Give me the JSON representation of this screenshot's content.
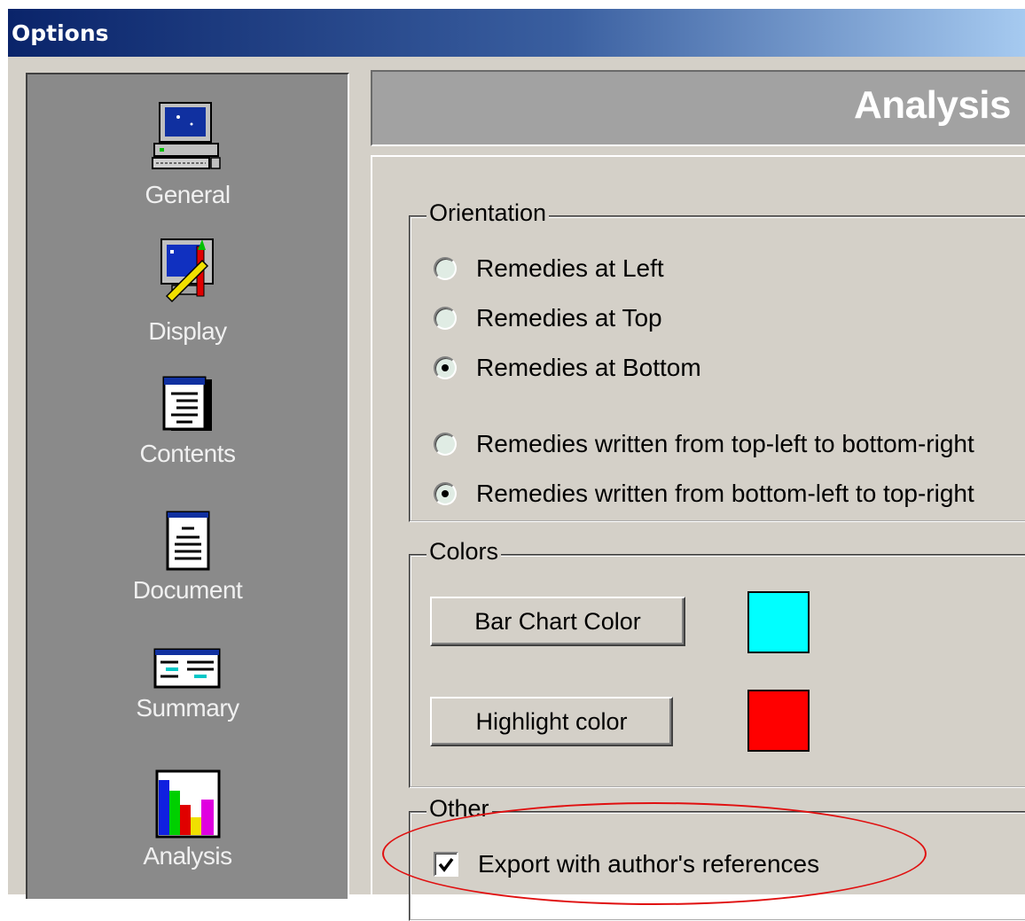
{
  "window": {
    "title": "Options"
  },
  "nav": {
    "items": [
      {
        "label": "General",
        "icon": "computer-icon"
      },
      {
        "label": "Display",
        "icon": "display-settings-icon"
      },
      {
        "label": "Contents",
        "icon": "contents-window-icon"
      },
      {
        "label": "Document",
        "icon": "document-icon"
      },
      {
        "label": "Summary",
        "icon": "summary-table-icon"
      },
      {
        "label": "Analysis",
        "icon": "bar-chart-icon",
        "selected": true
      }
    ]
  },
  "page": {
    "title": "Analysis"
  },
  "orientation": {
    "label": "Orientation",
    "options": [
      {
        "label": "Remedies at Left",
        "checked": false
      },
      {
        "label": "Remedies at Top",
        "checked": false
      },
      {
        "label": "Remedies at Bottom",
        "checked": true
      },
      {
        "label": "Remedies written from top-left to bottom-right",
        "checked": false
      },
      {
        "label": "Remedies written from bottom-left to top-right",
        "checked": true
      }
    ]
  },
  "colors": {
    "label": "Colors",
    "bar_chart_button": "Bar Chart Color",
    "bar_chart_color": "#00ffff",
    "highlight_button": "Highlight color",
    "highlight_color": "#ff0000"
  },
  "other": {
    "label": "Other",
    "export_refs_label": "Export with author's references",
    "export_refs_checked": true
  },
  "annotation": {
    "color": "#e01010"
  }
}
